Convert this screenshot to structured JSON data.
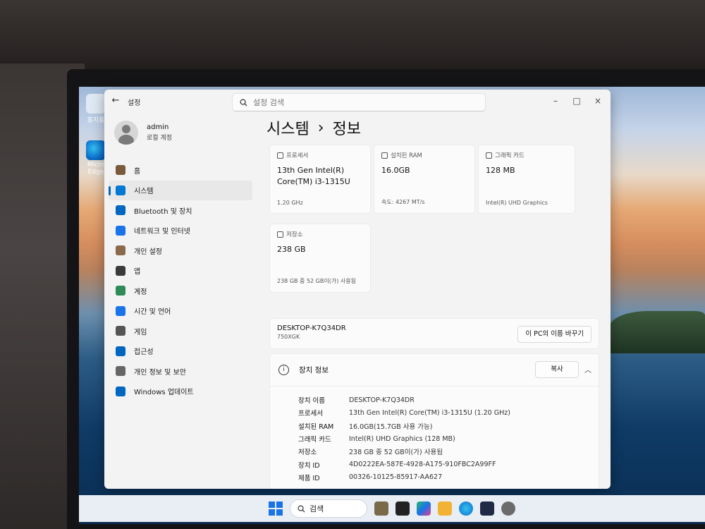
{
  "desktop": {
    "icons": [
      {
        "label": "휴지통",
        "icon": "recycle-bin-icon"
      },
      {
        "label": "Micro Edge",
        "icon": "edge-icon"
      }
    ]
  },
  "window": {
    "app_title": "설정",
    "search_placeholder": "설정 검색",
    "controls": {
      "minimize": "–",
      "maximize": "□",
      "close": "×"
    }
  },
  "profile": {
    "name": "admin",
    "subtitle": "로컬 계정"
  },
  "nav": [
    {
      "label": "홈",
      "icon": "home-icon",
      "color": "#7a5a3c"
    },
    {
      "label": "시스템",
      "icon": "system-icon",
      "color": "#0078d4",
      "active": true
    },
    {
      "label": "Bluetooth 및 장치",
      "icon": "bluetooth-icon",
      "color": "#0067c0"
    },
    {
      "label": "네트워크 및 인터넷",
      "icon": "network-icon",
      "color": "#1a73e8"
    },
    {
      "label": "개인 설정",
      "icon": "personalization-icon",
      "color": "#8a6a4a"
    },
    {
      "label": "앱",
      "icon": "apps-icon",
      "color": "#3a3a3a"
    },
    {
      "label": "계정",
      "icon": "accounts-icon",
      "color": "#2e8b57"
    },
    {
      "label": "시간 및 언어",
      "icon": "time-language-icon",
      "color": "#1a73e8"
    },
    {
      "label": "게임",
      "icon": "gaming-icon",
      "color": "#555555"
    },
    {
      "label": "접근성",
      "icon": "accessibility-icon",
      "color": "#0067c0"
    },
    {
      "label": "개인 정보 및 보안",
      "icon": "privacy-shield-icon",
      "color": "#666666"
    },
    {
      "label": "Windows 업데이트",
      "icon": "windows-update-icon",
      "color": "#0067c0"
    }
  ],
  "page": {
    "breadcrumb_parent": "시스템",
    "breadcrumb_sep": "›",
    "breadcrumb_current": "정보"
  },
  "cards": {
    "cpu": {
      "label": "프로세서",
      "value": "13th Gen Intel(R) Core(TM) i3-1315U",
      "detail": "1.20 GHz"
    },
    "ram": {
      "label": "설치된 RAM",
      "value": "16.0GB",
      "detail": "속도: 4267 MT/s"
    },
    "gpu": {
      "label": "그래픽 카드",
      "value": "128 MB",
      "detail": "Intel(R) UHD Graphics"
    },
    "storage": {
      "label": "저장소",
      "value": "238 GB",
      "detail": "238 GB 중 52 GB이(가) 사용됨"
    }
  },
  "device": {
    "name": "DESKTOP-K7Q34DR",
    "model": "750XGK",
    "rename_button": "이 PC의 이름 바꾸기"
  },
  "specs": {
    "title": "장치 정보",
    "copy_button": "복사",
    "rows": [
      {
        "key": "장치 이름",
        "value": "DESKTOP-K7Q34DR"
      },
      {
        "key": "프로세서",
        "value": "13th Gen Intel(R) Core(TM) i3-1315U (1.20 GHz)"
      },
      {
        "key": "설치된 RAM",
        "value": "16.0GB(15.7GB 사용 가능)"
      },
      {
        "key": "그래픽 카드",
        "value": "Intel(R) UHD Graphics (128 MB)"
      },
      {
        "key": "저장소",
        "value": "238 GB 중 52 GB이(가) 사용됨"
      },
      {
        "key": "장치 ID",
        "value": "4D0222EA-587E-4928-A175-910FBC2A99FF"
      },
      {
        "key": "제품 ID",
        "value": "00326-10125-85917-AA627"
      }
    ]
  },
  "taskbar": {
    "search_label": "검색"
  }
}
